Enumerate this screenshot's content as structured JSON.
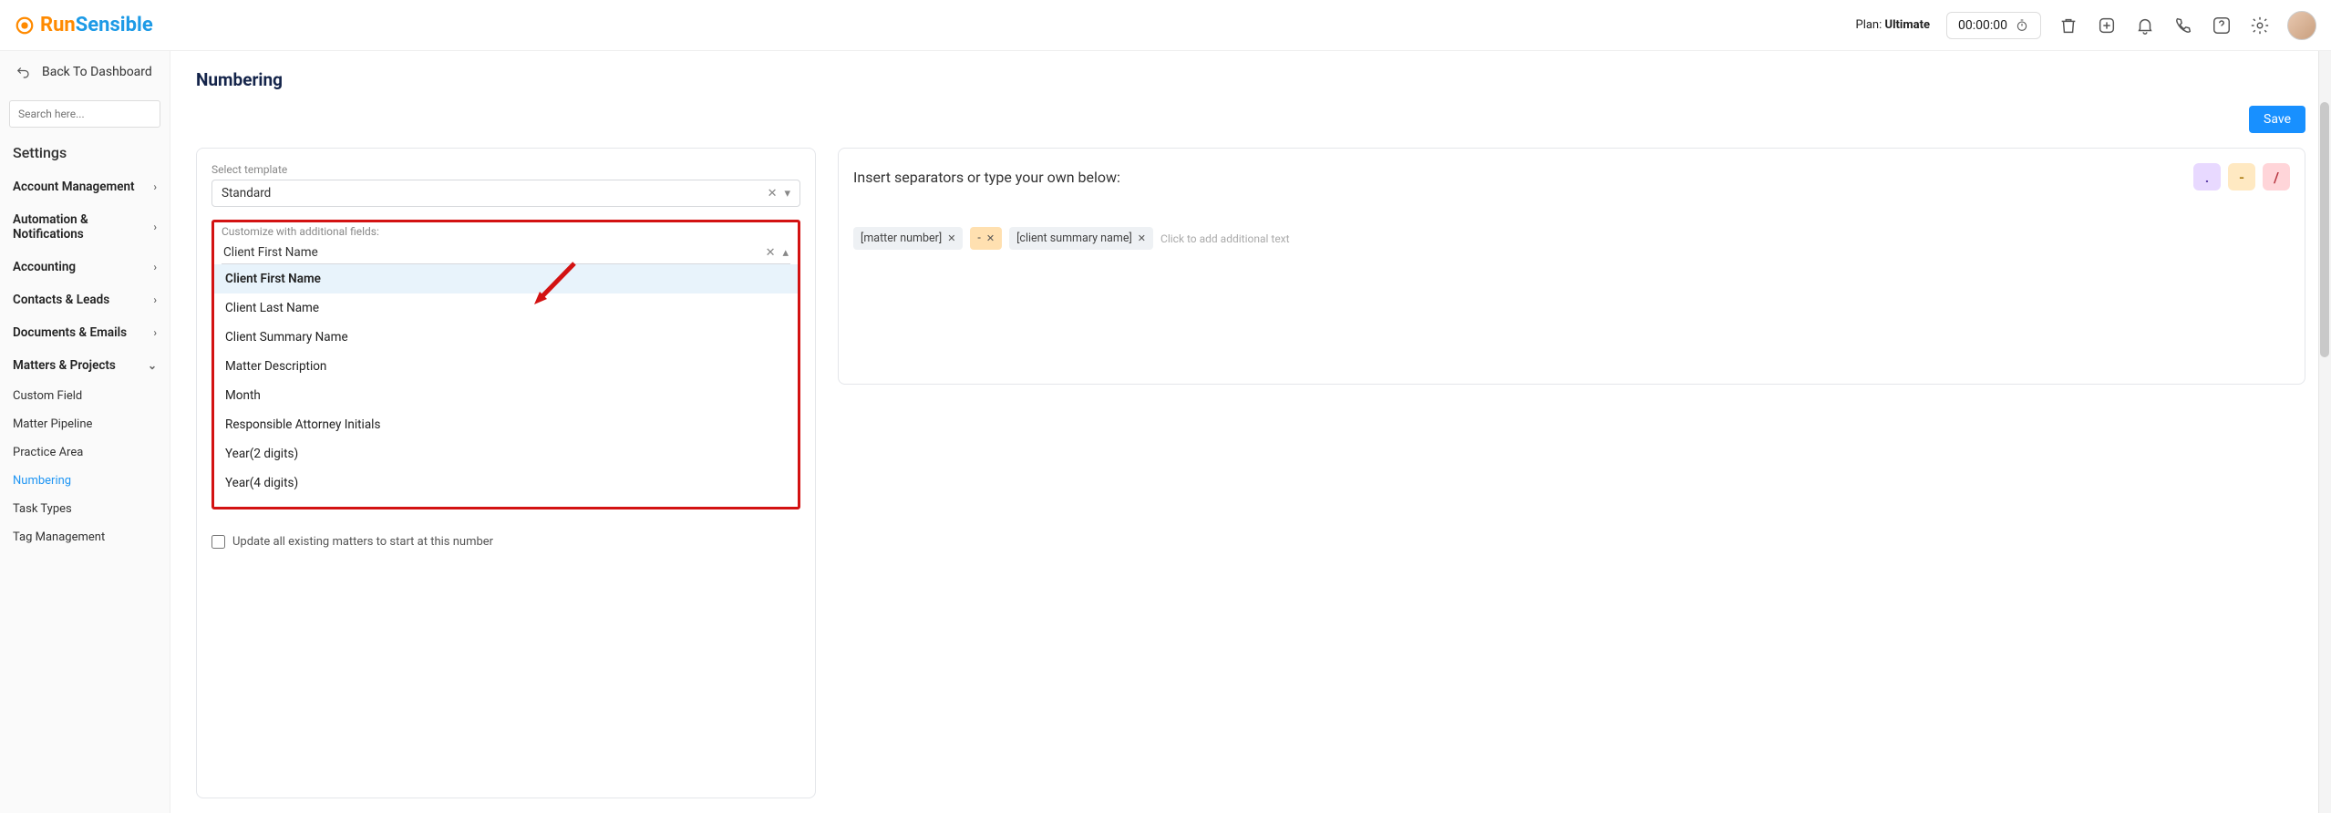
{
  "header": {
    "logo_run": "Run",
    "logo_sensible": "Sensible",
    "plan_label": "Plan:",
    "plan_value": "Ultimate",
    "timer": "00:00:00"
  },
  "sidebar": {
    "back": "Back To Dashboard",
    "search_placeholder": "Search here...",
    "settings_title": "Settings",
    "groups": [
      {
        "label": "Account Management"
      },
      {
        "label": "Automation & Notifications"
      },
      {
        "label": "Accounting"
      },
      {
        "label": "Contacts & Leads"
      },
      {
        "label": "Documents & Emails"
      }
    ],
    "matters_group": "Matters & Projects",
    "subs": [
      {
        "label": "Custom Field"
      },
      {
        "label": "Matter Pipeline"
      },
      {
        "label": "Practice Area"
      },
      {
        "label": "Numbering",
        "active": true
      },
      {
        "label": "Task Types"
      },
      {
        "label": "Tag Management"
      }
    ]
  },
  "page": {
    "title": "Numbering",
    "save": "Save",
    "select_template_label": "Select template",
    "select_template_value": "Standard",
    "customize_label": "Customize with additional fields:",
    "customize_value": "Client First Name",
    "dropdown": [
      "Client First Name",
      "Client Last Name",
      "Client Summary Name",
      "Matter Description",
      "Month",
      "Responsible Attorney Initials",
      "Year(2 digits)",
      "Year(4 digits)"
    ],
    "update_checkbox": "Update all existing matters to start at this number"
  },
  "right": {
    "title": "Insert separators or type your own below:",
    "sep_dot": ".",
    "sep_dash": "-",
    "sep_slash": "/",
    "tag1": "[matter number]",
    "tag_dash": "-",
    "tag2": "[client summary name]",
    "add_text": "Click to add additional text"
  }
}
